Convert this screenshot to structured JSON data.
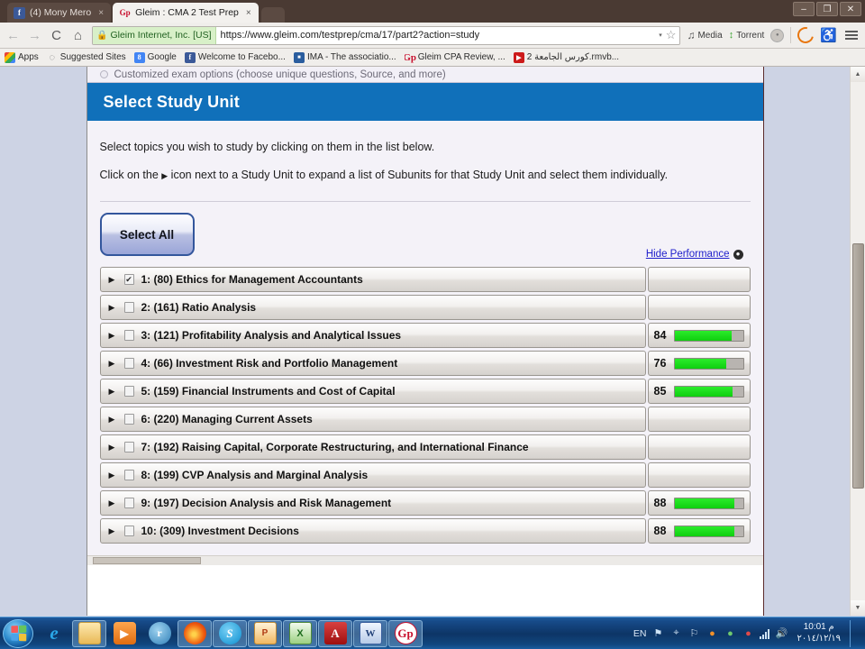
{
  "browser": {
    "tabs": [
      {
        "title": "(4) Mony Mero",
        "favicon": "facebook-icon",
        "favicon_glyph": "f",
        "active": false,
        "close_glyph": "×"
      },
      {
        "title": "Gleim : CMA 2 Test Prep",
        "favicon": "gleim-icon",
        "favicon_glyph": "Gp",
        "active": true,
        "close_glyph": "×"
      }
    ],
    "window_controls": {
      "minimize": "–",
      "restore": "❐",
      "close": "✕"
    },
    "nav": {
      "back": "←",
      "forward": "→",
      "reload": "C",
      "home": "⌂"
    },
    "address_bar": {
      "security_label": "Gleim Internet, Inc. [US]",
      "lock_icon": "lock-icon",
      "url": "https://www.gleim.com/testprep/cma/17/part2?action=study",
      "dropdown_glyph": "▾",
      "bookmark_star_glyph": "☆"
    },
    "extensions": [
      {
        "name": "media-extension",
        "label": "Media",
        "glyph": "♫"
      },
      {
        "name": "torrent-extension",
        "label": "Torrent",
        "glyph": "↕"
      }
    ],
    "menu_icon": "hamburger-menu-icon",
    "bookmarks": [
      {
        "label": "Apps",
        "icon": "apps-grid-icon",
        "glyph": ""
      },
      {
        "label": "Suggested Sites",
        "icon": "suggested-sites-icon",
        "glyph": "◌"
      },
      {
        "label": "Google",
        "icon": "google-icon",
        "glyph": "8"
      },
      {
        "label": "Welcome to Facebo...",
        "icon": "facebook-icon",
        "glyph": "f"
      },
      {
        "label": "IMA - The associatio...",
        "icon": "ima-icon",
        "glyph": "■"
      },
      {
        "label": "Gleim CPA Review, ...",
        "icon": "gleim-icon",
        "glyph": "Gp"
      },
      {
        "label": "كورس الجامعة 2.rmvb...",
        "icon": "video-icon",
        "glyph": "▶"
      }
    ]
  },
  "page": {
    "cut_off_row_text": "Customized exam options (choose unique questions, Source, and more)",
    "header_title": "Select Study Unit",
    "header_color": "#1070ba",
    "instructions": [
      "Select topics you wish to study by clicking on them in the list below.",
      "Click on the ▶ icon next to a Study Unit to expand a list of Subunits for that Study Unit and select them individually."
    ],
    "instruction_line2_pre": "Click on the ",
    "instruction_line2_tri": "▶",
    "instruction_line2_post": " icon next to a Study Unit to expand a list of Subunits for that Study Unit and select them individually.",
    "select_all_label": "Select All",
    "hide_performance_label": "Hide Performance",
    "hide_performance_badge": "●",
    "expand_arrow_glyph": "▶",
    "checkbox_checked_glyph": "✔",
    "performance_bar_color": "#22dd22",
    "study_units": [
      {
        "number": "1",
        "questions": "80",
        "title": "1: (80) Ethics for Management Accountants",
        "checked": true,
        "performance": null,
        "bar_pct": 0
      },
      {
        "number": "2",
        "questions": "161",
        "title": "2: (161) Ratio Analysis",
        "checked": false,
        "performance": null,
        "bar_pct": 0
      },
      {
        "number": "3",
        "questions": "121",
        "title": "3: (121) Profitability Analysis and Analytical Issues",
        "checked": false,
        "performance": "84",
        "bar_pct": 84
      },
      {
        "number": "4",
        "questions": "66",
        "title": "4: (66) Investment Risk and Portfolio Management",
        "checked": false,
        "performance": "76",
        "bar_pct": 76
      },
      {
        "number": "5",
        "questions": "159",
        "title": "5: (159) Financial Instruments and Cost of Capital",
        "checked": false,
        "performance": "85",
        "bar_pct": 85
      },
      {
        "number": "6",
        "questions": "220",
        "title": "6: (220) Managing Current Assets",
        "checked": false,
        "performance": null,
        "bar_pct": 0
      },
      {
        "number": "7",
        "questions": "192",
        "title": "7: (192) Raising Capital, Corporate Restructuring, and International Finance",
        "checked": false,
        "performance": null,
        "bar_pct": 0
      },
      {
        "number": "8",
        "questions": "199",
        "title": "8: (199) CVP Analysis and Marginal Analysis",
        "checked": false,
        "performance": null,
        "bar_pct": 0
      },
      {
        "number": "9",
        "questions": "197",
        "title": "9: (197) Decision Analysis and Risk Management",
        "checked": false,
        "performance": "88",
        "bar_pct": 88
      },
      {
        "number": "10",
        "questions": "309",
        "title": "10: (309) Investment Decisions",
        "checked": false,
        "performance": "88",
        "bar_pct": 88
      }
    ]
  },
  "taskbar": {
    "start_button": "start-button",
    "items": [
      {
        "name": "internet-explorer",
        "glyph": "e",
        "cls": "i-ie",
        "open": false
      },
      {
        "name": "windows-explorer",
        "glyph": "",
        "cls": "i-folder",
        "open": true
      },
      {
        "name": "media-player",
        "glyph": "▶",
        "cls": "i-media",
        "open": false
      },
      {
        "name": "tango-app",
        "glyph": "r",
        "cls": "i-tango",
        "open": false
      },
      {
        "name": "maxthon-browser",
        "glyph": "",
        "cls": "i-fire",
        "open": true
      },
      {
        "name": "skype",
        "glyph": "S",
        "cls": "i-skype",
        "open": true
      },
      {
        "name": "publisher",
        "glyph": "P",
        "cls": "i-pub",
        "open": true
      },
      {
        "name": "excel",
        "glyph": "X",
        "cls": "i-xls",
        "open": true
      },
      {
        "name": "adobe-reader",
        "glyph": "A",
        "cls": "i-pdf",
        "open": true
      },
      {
        "name": "word",
        "glyph": "W",
        "cls": "i-word",
        "open": true
      },
      {
        "name": "gleim-app",
        "glyph": "Gp",
        "cls": "i-gleim",
        "open": true
      }
    ],
    "tray": {
      "language": "EN",
      "icons": [
        {
          "name": "action-center-icon",
          "glyph": "⚑",
          "cls": "ti-1"
        },
        {
          "name": "network-tray-icon",
          "glyph": "⌖",
          "cls": "ti-2"
        },
        {
          "name": "flag-tray-icon",
          "glyph": "⚐",
          "cls": "ti-3"
        },
        {
          "name": "firefox-tray-icon",
          "glyph": "●",
          "cls": "ti-4"
        },
        {
          "name": "green-shield-icon",
          "glyph": "●",
          "cls": "ti-5"
        },
        {
          "name": "antivirus-tray-icon",
          "glyph": "●",
          "cls": "ti-6"
        }
      ],
      "signal_icon": "signal-bars-icon",
      "volume_icon": "volume-icon",
      "volume_glyph": "🔊",
      "time": "10:01 م",
      "date": "٢٠١٤/١٢/١٩"
    }
  }
}
